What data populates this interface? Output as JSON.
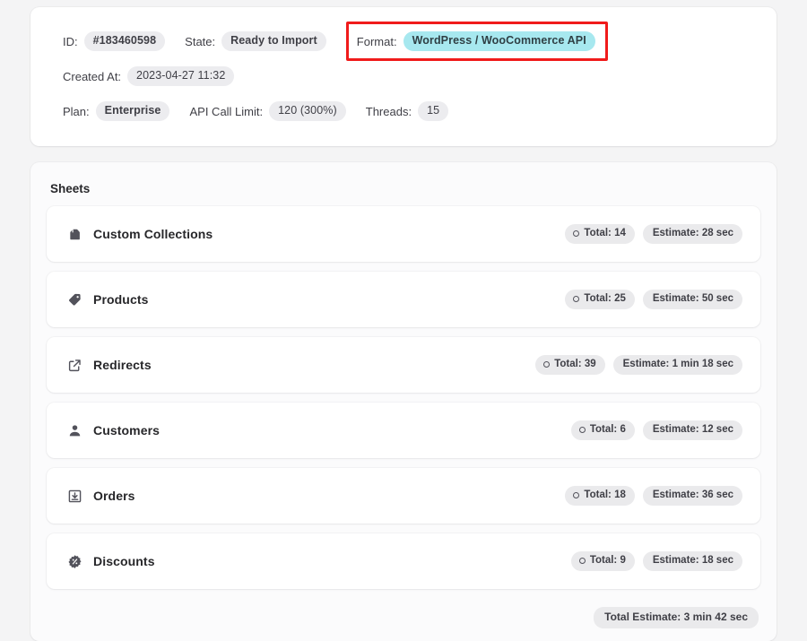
{
  "summary": {
    "rows": [
      {
        "fields": [
          {
            "label": "ID:",
            "value": "#183460598",
            "style": "plain"
          },
          {
            "label": "State:",
            "value": "Ready to Import",
            "style": "plain"
          }
        ],
        "highlighted_field": {
          "label": "Format:",
          "value": "WordPress / WooCommerce API",
          "style": "highlight"
        }
      },
      {
        "fields": [
          {
            "label": "Created At:",
            "value": "2023-04-27 11:32",
            "style": "plain"
          }
        ]
      },
      {
        "fields": [
          {
            "label": "Plan:",
            "value": "Enterprise",
            "style": "plain"
          },
          {
            "label": "API Call Limit:",
            "value": "120 (300%)",
            "style": "plain"
          },
          {
            "label": "Threads:",
            "value": "15",
            "style": "plain"
          }
        ]
      }
    ],
    "id_label": "ID:",
    "id_value": "#183460598",
    "state_label": "State:",
    "state_value": "Ready to Import",
    "format_label": "Format:",
    "format_value": "WordPress / WooCommerce API",
    "created_at_label": "Created At:",
    "created_at_value": "2023-04-27 11:32",
    "plan_label": "Plan:",
    "plan_value": "Enterprise",
    "api_call_limit_label": "API Call Limit:",
    "api_call_limit_value": "120 (300%)",
    "threads_label": "Threads:",
    "threads_value": "15"
  },
  "sheets": {
    "title": "Sheets",
    "items": [
      {
        "icon": "collection-bag-icon",
        "name": "Custom Collections",
        "total_label": "Total: 14",
        "estimate_label": "Estimate: 28 sec"
      },
      {
        "icon": "price-tag-icon",
        "name": "Products",
        "total_label": "Total: 25",
        "estimate_label": "Estimate: 50 sec"
      },
      {
        "icon": "external-link-icon",
        "name": "Redirects",
        "total_label": "Total: 39",
        "estimate_label": "Estimate: 1 min 18 sec"
      },
      {
        "icon": "person-icon",
        "name": "Customers",
        "total_label": "Total: 6",
        "estimate_label": "Estimate: 12 sec"
      },
      {
        "icon": "inbox-download-icon",
        "name": "Orders",
        "total_label": "Total: 18",
        "estimate_label": "Estimate: 36 sec"
      },
      {
        "icon": "discount-badge-icon",
        "name": "Discounts",
        "total_label": "Total: 9",
        "estimate_label": "Estimate: 18 sec"
      }
    ],
    "total_estimate_label": "Total Estimate: 3 min 42 sec"
  },
  "colors": {
    "page_background": "#f4f4f5",
    "card_background": "#ffffff",
    "sheets_card_background": "#fbfbfc",
    "chip_background": "#ececef",
    "highlight_chip_background": "#a7e8ef",
    "annotation_box": "#f01b1b",
    "text_primary": "#27272a",
    "text_secondary": "#3f3f46"
  }
}
